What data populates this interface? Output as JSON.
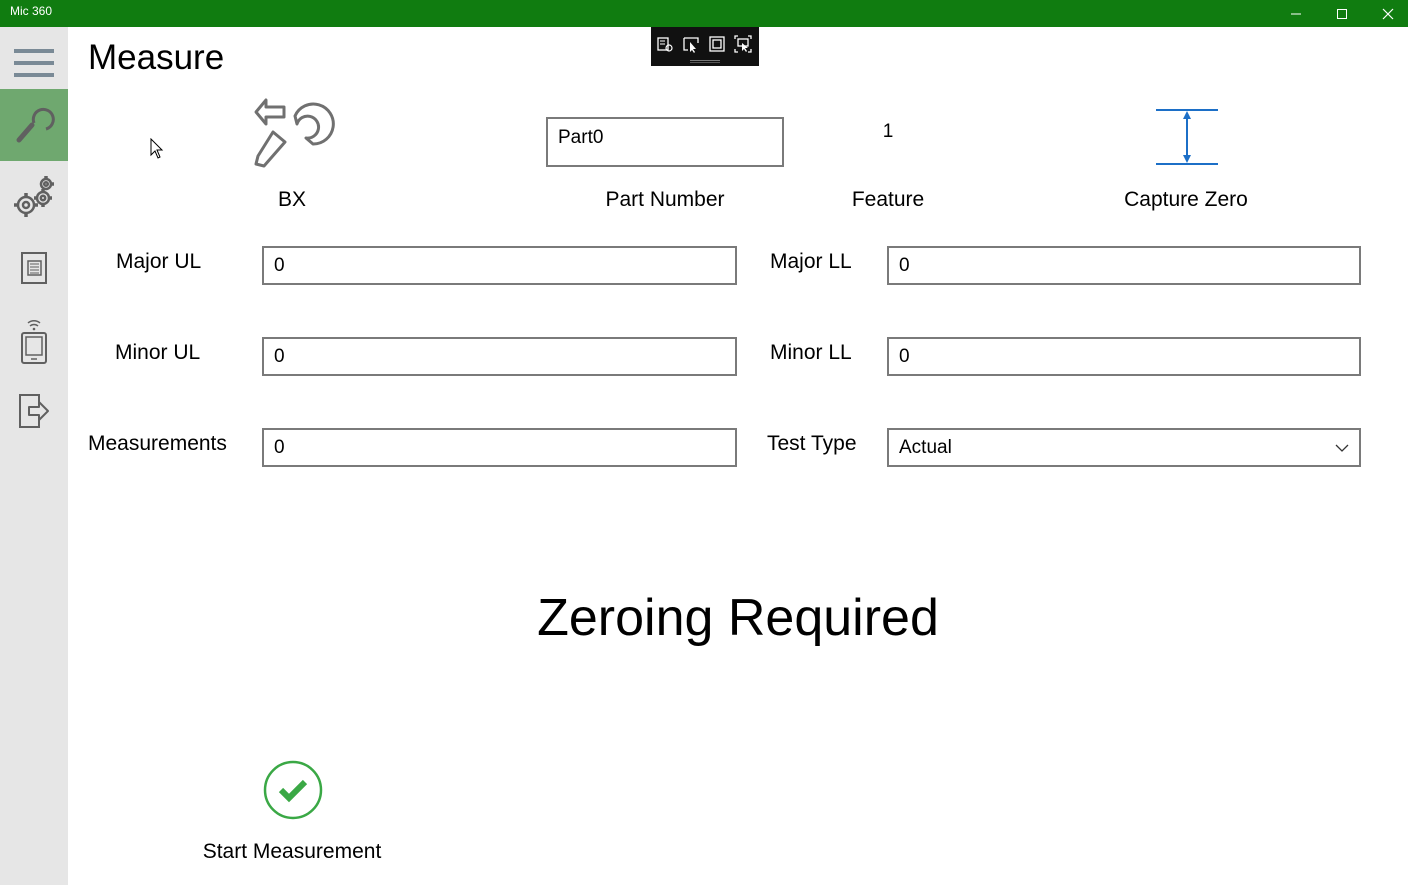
{
  "window": {
    "title": "Mic 360"
  },
  "page": {
    "title": "Measure"
  },
  "header": {
    "device_label": "BX",
    "part_number": {
      "value": "Part0",
      "label": "Part Number"
    },
    "feature": {
      "value": "1",
      "label": "Feature"
    },
    "capture_zero": {
      "label": "Capture Zero"
    }
  },
  "form": {
    "major_ul": {
      "label": "Major UL",
      "value": "0"
    },
    "major_ll": {
      "label": "Major LL",
      "value": "0"
    },
    "minor_ul": {
      "label": "Minor UL",
      "value": "0"
    },
    "minor_ll": {
      "label": "Minor LL",
      "value": "0"
    },
    "measurements": {
      "label": "Measurements",
      "value": "0"
    },
    "test_type": {
      "label": "Test Type",
      "value": "Actual"
    }
  },
  "status": {
    "message": "Zeroing Required"
  },
  "actions": {
    "start_label": "Start Measurement"
  },
  "colors": {
    "titlebar": "#107c10",
    "active_nav": "#6fa86f",
    "accent_blue": "#1c6fc7",
    "check_green": "#3aa845"
  },
  "icons": [
    "hamburger-icon",
    "micrometer-icon",
    "gears-icon",
    "report-icon",
    "device-icon",
    "exit-icon",
    "capture-zero-icon",
    "checkmark-icon"
  ]
}
